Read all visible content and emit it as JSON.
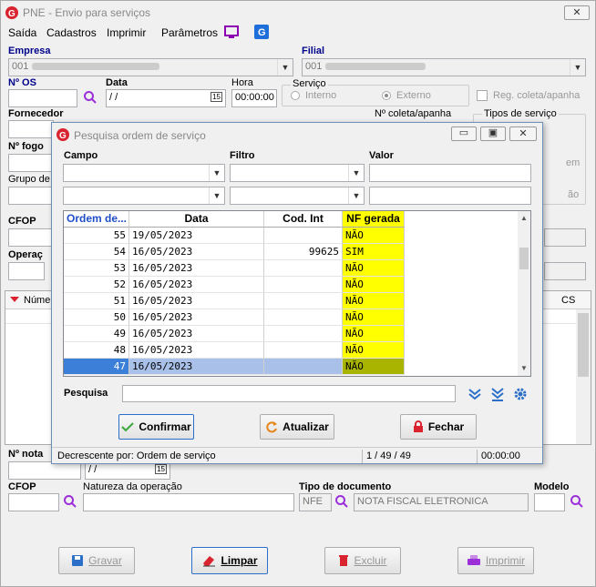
{
  "window": {
    "title": "PNE - Envio para serviços"
  },
  "menu": [
    "Saída",
    "Cadastros",
    "Imprimir",
    "Parâmetros"
  ],
  "form": {
    "empresa_label": "Empresa",
    "empresa_value": "001",
    "filial_label": "Filial",
    "filial_value": "001",
    "os_label": "Nº  OS",
    "data_label": "Data",
    "data_value": " / /",
    "hora_label": "Hora",
    "hora_value": "00:00:00",
    "servico_label": "Serviço",
    "interno_label": "Interno",
    "externo_label": "Externo",
    "reg_coleta_label": "Reg. coleta/apanha",
    "fornecedor_label": "Fornecedor",
    "coleta_label": "Nº coleta/apanha",
    "tipos_servico_label": "Tipos de serviço",
    "fogo_label": "Nº  fogo",
    "grupo_label": "Grupo de",
    "cfop_top_label": "CFOP",
    "operacao_label": "Operaç",
    "numero_col": "Númer",
    "cst_col": "CS",
    "nota_label": "Nº nota",
    "nota_date": " / /",
    "cfop_label": "CFOP",
    "natureza_label": "Natureza da operação",
    "tipo_doc_label": "Tipo de documento",
    "tipo_doc_code": "NFE",
    "tipo_doc_desc": "NOTA FISCAL ELETRONICA",
    "modelo_label": "Modelo",
    "hidden_right_1": "em",
    "hidden_right_2": "ão"
  },
  "bottom_buttons": {
    "gravar": "Gravar",
    "limpar": "Limpar",
    "excluir": "Excluir",
    "imprimir": "Imprimir"
  },
  "dialog": {
    "title": "Pesquisa ordem de serviço",
    "campo_label": "Campo",
    "filtro_label": "Filtro",
    "valor_label": "Valor",
    "columns": [
      "Ordem de...",
      "Data",
      "Cod. Int",
      "NF gerada"
    ],
    "rows": [
      {
        "ordem": "55",
        "data": "19/05/2023",
        "cod": "",
        "nf": "NÃO"
      },
      {
        "ordem": "54",
        "data": "16/05/2023",
        "cod": "99625",
        "nf": "SIM"
      },
      {
        "ordem": "53",
        "data": "16/05/2023",
        "cod": "",
        "nf": "NÃO"
      },
      {
        "ordem": "52",
        "data": "16/05/2023",
        "cod": "",
        "nf": "NÃO"
      },
      {
        "ordem": "51",
        "data": "16/05/2023",
        "cod": "",
        "nf": "NÃO"
      },
      {
        "ordem": "50",
        "data": "16/05/2023",
        "cod": "",
        "nf": "NÃO"
      },
      {
        "ordem": "49",
        "data": "16/05/2023",
        "cod": "",
        "nf": "NÃO"
      },
      {
        "ordem": "48",
        "data": "16/05/2023",
        "cod": "",
        "nf": "NÃO"
      },
      {
        "ordem": "47",
        "data": "16/05/2023",
        "cod": "",
        "nf": "NÃO"
      }
    ],
    "pesquisa_label": "Pesquisa",
    "confirmar": "Confirmar",
    "atualizar": "Atualizar",
    "fechar": "Fechar",
    "status_sort": "Decrescente por: Ordem de serviço",
    "status_count": "1 / 49 / 49",
    "status_time": "00:00:00"
  },
  "colors": {
    "accent": "#2b6fc9",
    "yellow": "#ffff00",
    "selected": "#3c7fd9",
    "red": "#d9232e"
  }
}
